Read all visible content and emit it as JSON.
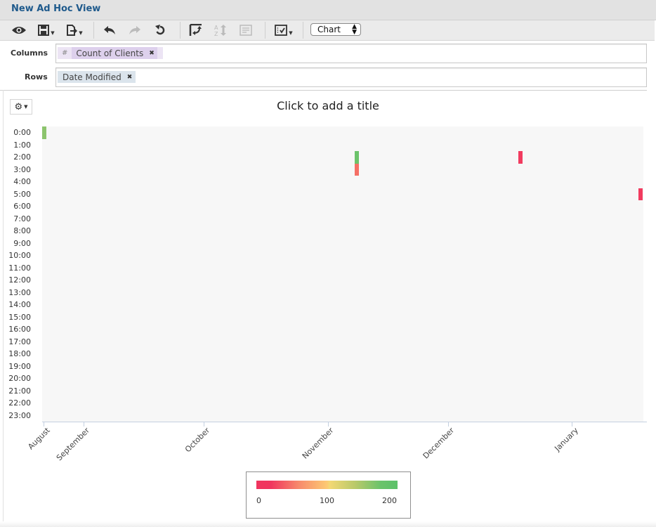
{
  "window": {
    "title": "New Ad Hoc View"
  },
  "toolbar": {
    "icons": [
      "eye-icon",
      "save-icon",
      "export-icon",
      "undo-icon",
      "redo-icon",
      "reset-icon",
      "pivot-icon",
      "sort-icon",
      "page-icon",
      "options-icon"
    ],
    "view_select": "Chart"
  },
  "columns": {
    "label": "Columns",
    "pills": [
      {
        "prefix": "#",
        "label": "Count of Clients"
      }
    ]
  },
  "rows": {
    "label": "Rows",
    "pills": [
      {
        "label": "Date Modified"
      }
    ]
  },
  "chart_title": "Click to add a title",
  "chart_data": {
    "type": "heatmap",
    "title": "Click to add a title",
    "xlabel": "",
    "ylabel": "",
    "x_ticks": [
      "August",
      "September",
      "October",
      "November",
      "December",
      "January"
    ],
    "y_ticks": [
      "0:00",
      "1:00",
      "2:00",
      "3:00",
      "4:00",
      "5:00",
      "6:00",
      "7:00",
      "8:00",
      "9:00",
      "10:00",
      "11:00",
      "12:00",
      "13:00",
      "14:00",
      "15:00",
      "16:00",
      "17:00",
      "18:00",
      "19:00",
      "20:00",
      "21:00",
      "22:00",
      "23:00"
    ],
    "x_range": [
      "Aug 22",
      "Jan 19"
    ],
    "points": [
      {
        "date": "Aug 22",
        "hour": "0:00",
        "value": 170
      },
      {
        "date": "Nov 8",
        "hour": "2:00",
        "value": 190
      },
      {
        "date": "Nov 8",
        "hour": "3:00",
        "value": 40
      },
      {
        "date": "Dec 19",
        "hour": "2:00",
        "value": 5
      },
      {
        "date": "Jan 18",
        "hour": "5:00",
        "value": 5
      }
    ],
    "color_scale": {
      "min": 0,
      "mid": 100,
      "max": 200,
      "colors": [
        "#f0345e",
        "#fdc973",
        "#5cc26a"
      ]
    },
    "legend": {
      "labels": [
        "0",
        "100",
        "200"
      ],
      "position": "bottom-center"
    }
  }
}
